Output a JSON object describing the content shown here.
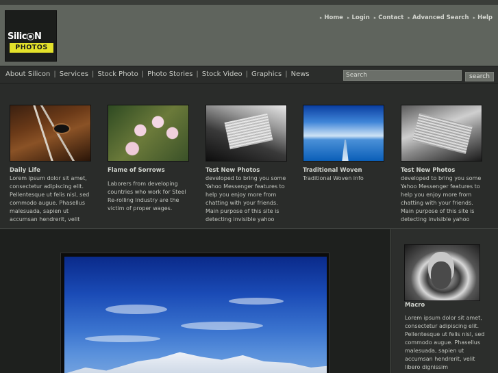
{
  "header": {
    "logo": {
      "line1_a": "Silic",
      "line1_b": "N",
      "line2": "PHOTOS"
    },
    "links": [
      "Home",
      "Login",
      "Contact",
      "Advanced Search",
      "Help"
    ]
  },
  "nav": {
    "items": [
      "About Silicon",
      "Services",
      "Stock Photo",
      "Photo Stories",
      "Stock Video",
      "Graphics",
      "News"
    ],
    "separator": "|"
  },
  "search": {
    "placeholder": "Search",
    "button": "search"
  },
  "cards": [
    {
      "title": "Daily Life",
      "image": "horse-photo",
      "body": "Lorem ipsum dolor sit amet, consectetur adipiscing elit. Pellentesque ut felis nisl, sed commodo augue. Phasellus malesuada, sapien ut accumsan hendrerit, velit libero dignissim"
    },
    {
      "title": "Flame of Sorrows",
      "image": "flower-photo",
      "body": "Laborers from developing countries who work for Steel Re-rolling Industry are the victim of proper wages."
    },
    {
      "title": "Test New Photos",
      "image": "book-photo",
      "body": "developed to bring you some Yahoo Messenger features to help you enjoy more from chatting with your friends. Main purpose of this site is detecting invisible yahoo messenger users. If you chat in Yahoo Messenger and you"
    },
    {
      "title": "Traditional Woven",
      "image": "sea-photo",
      "body": "Traditional Woven info"
    },
    {
      "title": "Test New Photos",
      "image": "book-photo",
      "body": "developed to bring you some Yahoo Messenger features to help you enjoy more from chatting with your friends. Main purpose of this site is detecting invisible yahoo messenger users. If you chat in Yahoo Messenger and you"
    }
  ],
  "sidebar": {
    "title": "Macro",
    "image": "portrait-photo",
    "body": "Lorem ipsum dolor sit amet, consectetur adipiscing elit. Pellentesque ut felis nisl, sed commodo augue. Phasellus malesuada, sapien ut accumsan hendrerit, velit libero dignissim"
  },
  "hero": {
    "image": "mountain-photo"
  },
  "colors": {
    "header_bg": "#5f645d",
    "nav_bg": "#2b2d2b",
    "body_bg": "#2a2c2a",
    "logo_yellow": "#e3e12a"
  }
}
